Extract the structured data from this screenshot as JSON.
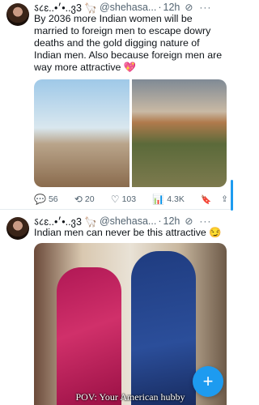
{
  "tweets": [
    {
      "author_name": "ऽ८ɛ..•׳•..ვ3 🦙",
      "handle": "@shehasa...",
      "separator": "·",
      "time": "12h",
      "text": "By 2036 more Indian women will be married to foreign men to escape dowry deaths and the gold digging nature of Indian men. Also because foreign men are way more attractive 💖",
      "stats": {
        "replies": "56",
        "retweets": "20",
        "likes": "103",
        "views": "4.3K"
      }
    },
    {
      "author_name": "ऽ८ɛ..•׳•..ვ3 🦙",
      "handle": "@shehasa...",
      "separator": "·",
      "time": "12h",
      "text": "Indian men can never be this attractive 😏",
      "video_caption": "POV: Your American hubby"
    }
  ],
  "icons": {
    "grok": "⊘",
    "more": "···",
    "reply": "💬",
    "retweet": "⟲",
    "like": "♡",
    "views": "📊",
    "bookmark": "🔖",
    "share": "⇪",
    "fab": "+"
  },
  "colors": {
    "accent": "#1d9bf0",
    "text": "#0f1419",
    "muted": "#536471"
  }
}
